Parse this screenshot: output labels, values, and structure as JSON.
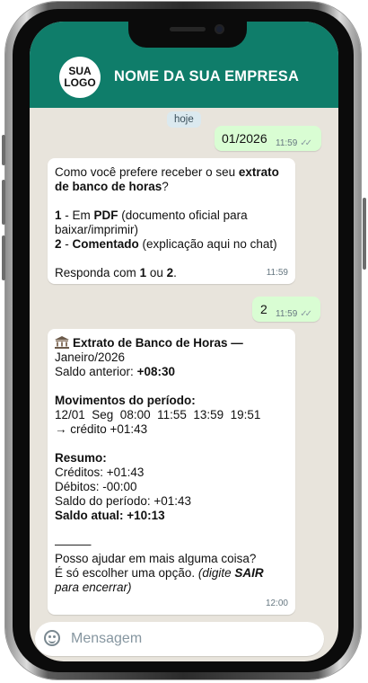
{
  "header": {
    "logo_line1": "SUA",
    "logo_line2": "LOGO",
    "company_name": "NOME DA SUA EMPRESA"
  },
  "chat": {
    "date_chip": "hoje",
    "msg1": {
      "text": "01/2026",
      "time": "11:59",
      "status": "read"
    },
    "msg2": {
      "q_a": "Como você prefere receber o seu ",
      "q_b": "extrato",
      "q_c": "de banco de horas",
      "q_d": "?",
      "opt1_num": "1",
      "opt1_mid": " - Em ",
      "opt1_bold": "PDF",
      "opt1_rest": " (documento oficial para",
      "opt1_line2": "baixar/imprimir)",
      "opt2_num": "2",
      "opt2_sep": " - ",
      "opt2_bold": "Comentado",
      "opt2_rest": " (explicação aqui no chat)",
      "reply_a": "Responda com ",
      "reply_b": "1",
      "reply_c": " ou ",
      "reply_d": "2",
      "reply_e": ".",
      "time": "11:59"
    },
    "msg3": {
      "text": "2",
      "time": "11:59",
      "status": "read"
    },
    "msg4": {
      "icon": "bank-icon",
      "title_a": "Extrato de Banco de Horas —",
      "title_b": "Janeiro/2026",
      "saldo_ant_label": "Saldo anterior: ",
      "saldo_ant_value": "+08:30",
      "mov_title": "Movimentos do período:",
      "mov_line": "12/01  Seg  08:00  11:55  13:59  19:51",
      "mov_credit": "→ crédito +01:43",
      "resumo_title": "Resumo:",
      "creditos": "Créditos: +01:43",
      "debitos": "Débitos: -00:00",
      "saldo_periodo": "Saldo do período: +01:43",
      "saldo_atual": "Saldo atual: +10:13",
      "separator": "———",
      "help": "Posso ajudar em mais alguma coisa?",
      "option_a": "É só escolher uma opção. ",
      "option_b": "(digite ",
      "option_c": "SAIR",
      "option_d": "para encerrar)",
      "time": "12:00"
    }
  },
  "input": {
    "placeholder": "Mensagem",
    "icon": "emoji-icon"
  },
  "colors": {
    "header": "#0f7d6a",
    "chat_background": "#e8e4dc",
    "outgoing_bubble": "#d9fdd3",
    "incoming_bubble": "#ffffff"
  }
}
